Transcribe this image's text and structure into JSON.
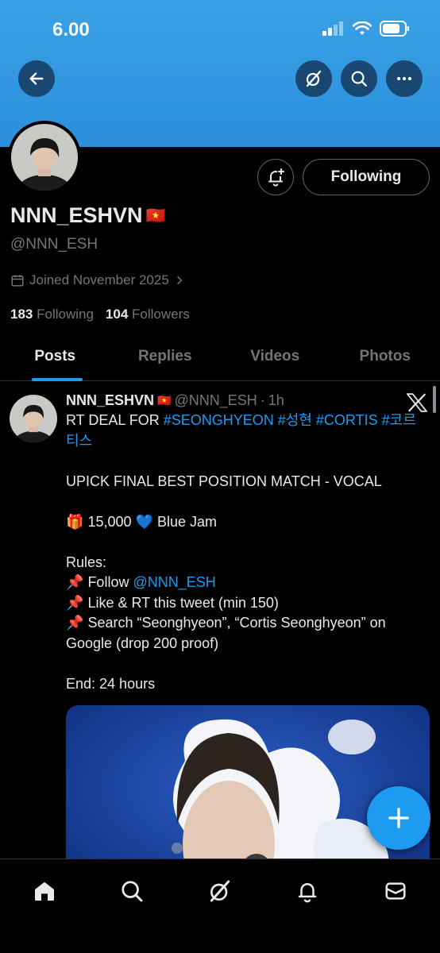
{
  "status_bar": {
    "time": "6.00"
  },
  "profile": {
    "display_name": "NNN_ESHVN",
    "flag": "🇻🇳",
    "handle": "@NNN_ESH",
    "joined": "Joined November 2025",
    "following_count": "183",
    "following_label": "Following",
    "followers_count": "104",
    "followers_label": "Followers",
    "follow_button_label": "Following"
  },
  "tabs": [
    {
      "label": "Posts",
      "active": true
    },
    {
      "label": "Replies",
      "active": false
    },
    {
      "label": "Videos",
      "active": false
    },
    {
      "label": "Photos",
      "active": false
    }
  ],
  "tweet": {
    "name": "NNN_ESHVN",
    "flag": "🇻🇳",
    "handle": "@NNN_ESH",
    "sep": "·",
    "time": "1h",
    "line1_prefix": "RT DEAL FOR ",
    "line1_tags": [
      "#SEONGHYEON",
      "#성현",
      "#CORTIS",
      "#코르티스"
    ],
    "title": "UPICK FINAL BEST POSITION MATCH - VOCAL",
    "prize_icon": "🎁",
    "prize_amount": "15,000",
    "prize_heart": "💙",
    "prize_label": "Blue Jam",
    "rules_heading": "Rules:",
    "pin": "📌",
    "rule1_prefix": "Follow ",
    "rule1_mention": "@NNN_ESH",
    "rule2": "Like & RT this tweet (min 150)",
    "rule3": "Search “Seonghyeon”, “Cortis Seonghyeon” on Google (drop 200 proof)",
    "end": "End: 24 hours"
  },
  "colors": {
    "accent": "#1d9bf0",
    "banner": "#3aa1e6",
    "muted": "#71767b",
    "text": "#e7e9ea"
  }
}
